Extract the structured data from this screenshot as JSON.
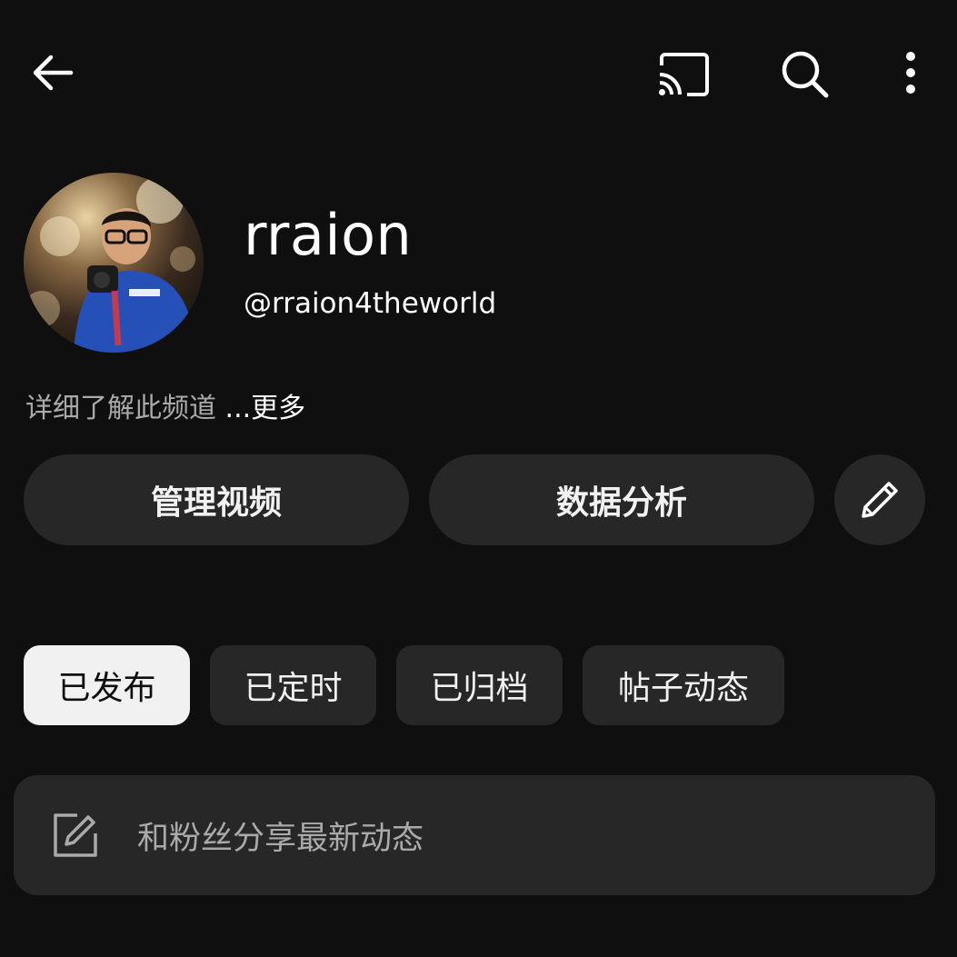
{
  "header": {
    "back_icon": "arrow-left-icon",
    "cast_icon": "cast-icon",
    "search_icon": "search-icon",
    "more_icon": "more-vertical-icon"
  },
  "channel": {
    "name": "rraion",
    "handle": "@rraion4theworld",
    "about_text": "详细了解此频道 ",
    "about_more": "...更多"
  },
  "actions": {
    "manage_label": "管理视频",
    "analytics_label": "数据分析",
    "edit_icon": "pencil-icon"
  },
  "tabs": [
    {
      "label": "已发布",
      "active": true
    },
    {
      "label": "已定时",
      "active": false
    },
    {
      "label": "已归档",
      "active": false
    },
    {
      "label": "帖子动态",
      "active": false
    }
  ],
  "composer": {
    "icon": "edit-square-icon",
    "placeholder": "和粉丝分享最新动态"
  },
  "colors": {
    "background": "#0f0f0f",
    "surface": "#272727",
    "text": "#f1f1f1",
    "muted": "#aaaaaa"
  }
}
